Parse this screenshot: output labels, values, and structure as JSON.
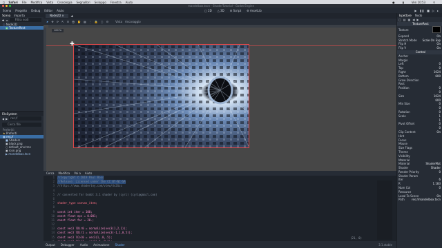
{
  "macbar": {
    "app": "Safari",
    "menus": [
      "File",
      "Modifica",
      "Vista",
      "Cronologia",
      "Segnalibri",
      "Sviluppo",
      "Finestra",
      "Aiuto"
    ],
    "time": "Ven 10:53"
  },
  "window": {
    "title": "mandelbox.tscn - ShaderTutorial - Godot Engine"
  },
  "menubar": {
    "items": [
      "Scena",
      "Progetto",
      "Debug",
      "Editor",
      "Aiuto"
    ],
    "workspaces": [
      "2D",
      "3D",
      "Script",
      "AssetLib"
    ],
    "active_workspace": "2D"
  },
  "scene_dock": {
    "tabs": [
      "Scena",
      "Importa"
    ],
    "search_placeholder": "Filtra nodi",
    "nodes": [
      {
        "label": "Node2D",
        "selected": false
      },
      {
        "label": "TextureRect",
        "selected": true
      }
    ]
  },
  "filesystem": {
    "tab": "FileSystem",
    "path": "res://",
    "search_placeholder": "Cerca file",
    "section": "Preferiti:",
    "items": [
      {
        "label": "Preferiti",
        "selected": false
      },
      {
        "label": "res://",
        "selected": true
      },
      {
        "label": "Shaders",
        "selected": false
      },
      {
        "label": "black.png",
        "selected": false
      },
      {
        "label": "default_env.tres",
        "selected": false
      },
      {
        "label": "icon.png",
        "selected": false
      },
      {
        "label": "mandelbox.tscn",
        "selected": false
      }
    ]
  },
  "editor": {
    "scene_tab": "Node2D",
    "toolbar_labels": [
      "Vista",
      "Ancoraggio"
    ],
    "zoom_reset": "100 %"
  },
  "script_editor": {
    "menu": [
      "Cerca",
      "Modifica",
      "Vai a",
      "Aiuto"
    ],
    "lines": [
      {
        "n": "1",
        "t": "//Copyright © 2019 Paul Ross"
      },
      {
        "n": "2",
        "t": "//Release: Licensed under the CC BY-NC-SA"
      },
      {
        "n": "3",
        "t": "//https://www.shadertoy.com/view/4s2Gzc"
      },
      {
        "n": "4",
        "t": ""
      },
      {
        "n": "5",
        "t": "// converted for Godot 3.1 shader by (cyri) (cyri@gmail.com)"
      },
      {
        "n": "6",
        "t": ""
      },
      {
        "n": "7",
        "t": "shader_type canvas_item;"
      },
      {
        "n": "8",
        "t": ""
      },
      {
        "n": "9",
        "t": "const int iter = 100;"
      },
      {
        "n": "10",
        "t": "const float eps = 0.001;"
      },
      {
        "n": "11",
        "t": "const float far = 20.;"
      },
      {
        "n": "12",
        "t": ""
      },
      {
        "n": "13",
        "t": "const vec3 lDir0 = normalize(vec3(1,2,1));"
      },
      {
        "n": "14",
        "t": "const vec3 lDir1 = normalize(vec3(-1,1,0.5));"
      },
      {
        "n": "15",
        "t": "const vec3 lCol0 = vec3(1,.8,.5);"
      },
      {
        "n": "16",
        "t": "const vec3 lCol1 = vec3(.6,.8,1);"
      }
    ],
    "status": "(21, 0)"
  },
  "bottom_tabs": {
    "items": [
      "Output",
      "Debugger",
      "Audio",
      "Animazione",
      "Shader"
    ],
    "active": "Shader",
    "version": "3.1.stable"
  },
  "inspector": {
    "tabs": [
      "Ispettore",
      "Nodo"
    ],
    "class": "TextureRect",
    "rows": [
      {
        "k": "Texture",
        "v": "■"
      },
      {
        "k": "Expand",
        "v": "On"
      },
      {
        "k": "Stretch Mode",
        "v": "Scale On Exp"
      },
      {
        "k": "Flip H",
        "v": "On"
      },
      {
        "k": "Flip V",
        "v": "On"
      }
    ],
    "control_header": "Control",
    "layout_rows": [
      {
        "k": "Anchor",
        "v": ""
      },
      {
        "k": "Margin",
        "v": ""
      },
      {
        "k": "Left",
        "v": "0"
      },
      {
        "k": "Top",
        "v": "0"
      },
      {
        "k": "Right",
        "v": "1024"
      },
      {
        "k": "Bottom",
        "v": "600"
      },
      {
        "k": "Grow Direction",
        "v": ""
      },
      {
        "k": "Rect",
        "v": ""
      },
      {
        "k": "Position",
        "v": "0"
      },
      {
        "k": "",
        "v": "0"
      },
      {
        "k": "Size",
        "v": "1024"
      },
      {
        "k": "",
        "v": "600"
      },
      {
        "k": "Min Size",
        "v": "0"
      },
      {
        "k": "",
        "v": "0"
      },
      {
        "k": "Rotation",
        "v": "0"
      },
      {
        "k": "Scale",
        "v": "1"
      },
      {
        "k": "",
        "v": "1"
      },
      {
        "k": "Pivot Offset",
        "v": "0"
      },
      {
        "k": "",
        "v": "0"
      },
      {
        "k": "Clip Content",
        "v": "On"
      },
      {
        "k": "Hint",
        "v": ""
      },
      {
        "k": "Focus",
        "v": ""
      },
      {
        "k": "Mouse",
        "v": ""
      },
      {
        "k": "Size Flags",
        "v": ""
      },
      {
        "k": "Theme",
        "v": ""
      },
      {
        "k": "Visibility",
        "v": ""
      },
      {
        "k": "Material",
        "v": ""
      },
      {
        "k": "Material",
        "v": "ShaderMat"
      },
      {
        "k": "Shader",
        "v": "Shader"
      },
      {
        "k": "Render Priority",
        "v": "0"
      },
      {
        "k": "Shader Param",
        "v": ""
      },
      {
        "k": "Iter",
        "v": "6"
      },
      {
        "k": "R",
        "v": "1.183"
      },
      {
        "k": "Num Col",
        "v": "0"
      },
      {
        "k": "Resource",
        "v": ""
      },
      {
        "k": "Local To Scene",
        "v": "On"
      },
      {
        "k": "Path",
        "v": "res://mandelbox.tscn"
      }
    ]
  }
}
